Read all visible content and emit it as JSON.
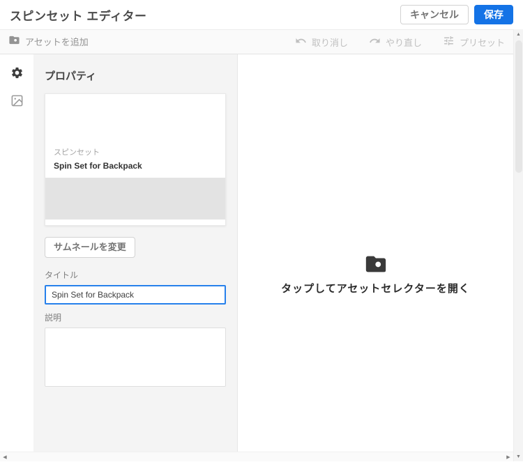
{
  "header": {
    "title": "スピンセット エディター",
    "cancel_label": "キャンセル",
    "save_label": "保存"
  },
  "toolbar": {
    "add_asset_label": "アセットを追加",
    "undo_label": "取り消し",
    "redo_label": "やり直し",
    "preset_label": "プリセット"
  },
  "properties_panel": {
    "heading": "プロパティ",
    "thumbnail_card": {
      "type_label": "スピンセット",
      "title": "Spin Set for Backpack"
    },
    "change_thumbnail_label": "サムネールを変更",
    "title_field": {
      "label": "タイトル",
      "value": "Spin Set for Backpack"
    },
    "description_field": {
      "label": "説明",
      "value": ""
    }
  },
  "main_area": {
    "empty_state_text": "タップしてアセットセレクターを開く"
  },
  "icons": {
    "add_asset": "folder-search-icon",
    "undo": "undo-arrow-icon",
    "redo": "redo-arrow-icon",
    "preset": "sliders-icon",
    "rail_active": "gear-icon",
    "rail_secondary": "image-icon",
    "empty_state": "folder-search-icon"
  },
  "scrollbar": {
    "up": "▲",
    "down": "▼",
    "left": "◀",
    "right": "▶"
  },
  "colors": {
    "accent_blue": "#1473e6",
    "focus_border": "#2680eb",
    "panel_bg": "#f4f4f4",
    "toolbar_bg": "#fafafa"
  }
}
